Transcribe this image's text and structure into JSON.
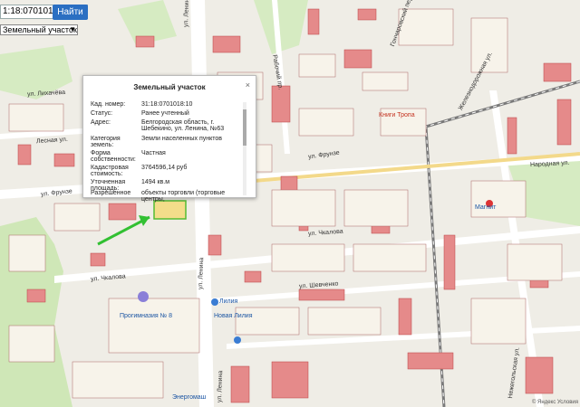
{
  "search": {
    "value": "1:18:0701018:10",
    "button": "Найти"
  },
  "layer": {
    "selected": "Земельный участок"
  },
  "popup": {
    "title": "Земельный участок",
    "close": "×",
    "rows": [
      {
        "k": "Кад. номер:",
        "v": "31:18:0701018:10"
      },
      {
        "k": "Статус:",
        "v": "Ранее учтенный"
      },
      {
        "k": "Адрес:",
        "v": "Белгородская область, г. Шебекино, ул. Ленина, №63"
      },
      {
        "k": "Категория земель:",
        "v": "Земли населенных пунктов"
      },
      {
        "k": "Форма собственности:",
        "v": "Частная"
      },
      {
        "k": "Кадастровая стоимость:",
        "v": "3764596,14 руб"
      },
      {
        "k": "Уточненная площадь:",
        "v": "1494 кв.м"
      },
      {
        "k": "Разрешенное",
        "v": "объекты торговли (торговые центры,"
      }
    ]
  },
  "streets": [
    "ул. Ленина",
    "ул. Ленина",
    "ул. Ленина",
    "ул. Фрунзе",
    "ул. Фрунзе",
    "Лесная ул.",
    "ул. Чкалова",
    "ул. Чкалова",
    "ул. Шевченко",
    "Рабочий пр.",
    "Железнодорожная ул.",
    "Нежегольская ул.",
    "Народная ул.",
    "ул. Лихачёва",
    "Гончаровский пер."
  ],
  "pois": [
    "Книги Тропа",
    "Прогимназия № 8",
    "Лилия",
    "Новая Лилия",
    "Энергомаш",
    "Магнит"
  ],
  "copyright": "© Яндекс Условия"
}
